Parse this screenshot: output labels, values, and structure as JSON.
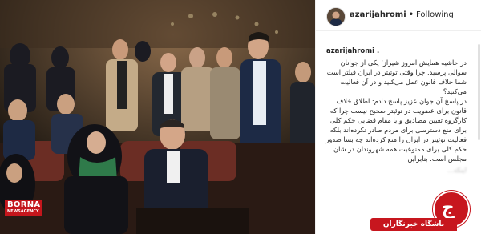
{
  "photo": {
    "watermark_title": "BORNA",
    "watermark_subtitle": "NEWSAGENCY"
  },
  "post_header": {
    "username": "azarijahromi",
    "separator": "•",
    "follow_label": "Following"
  },
  "caption": {
    "username": "azarijahromi .",
    "paragraphs": [
      "در حاشیه همایش امروز شیراز؛ یکی از جوانان سوالی پرسید. چرا وقتی توئیتر در ایران فیلتر است شما خلاف قانون عمل می‌کنید و در آن فعالیت می‌کنید؟",
      "در پاسخ آن جوان عزیز پاسخ دادم: اطلاق خلاف قانون برای عضویت در توئیتر صحیح نیست چرا که کارگروه تعیین مصادیق و یا مقام قضایی حکم کلی برای منع دسترسی برای مردم صادر نکرده‌اند بلکه فعالیت توئیتر در ایران را منع کرده‌اند چه بسا صدور حکم کلی برای ممنوعیت همه شهروندان در شان مجلس است. بنابراین"
    ],
    "faded_line": "اینکه..."
  },
  "brand": {
    "logo_glyph": "ج",
    "logo_text": "باشگاه خبرنگاران"
  },
  "colors": {
    "brand_red": "#c7161e",
    "watermark_red": "#c4161c",
    "text": "#262626",
    "border": "#efefef"
  }
}
